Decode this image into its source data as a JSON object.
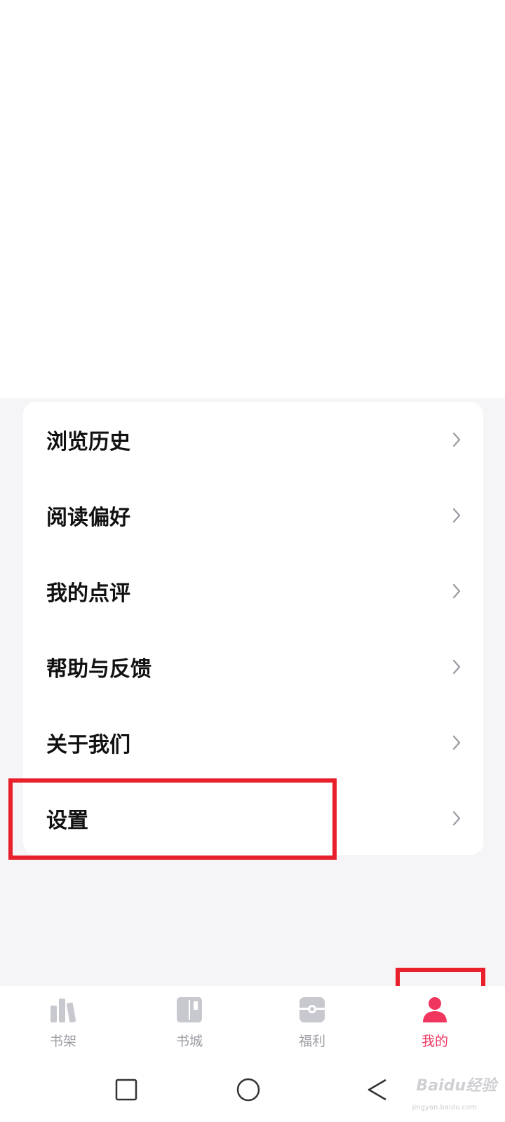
{
  "menu": {
    "items": [
      {
        "label": "浏览历史"
      },
      {
        "label": "阅读偏好"
      },
      {
        "label": "我的点评"
      },
      {
        "label": "帮助与反馈"
      },
      {
        "label": "关于我们"
      },
      {
        "label": "设置"
      }
    ]
  },
  "tabbar": {
    "tabs": [
      {
        "label": "书架",
        "icon": "bookshelf-icon",
        "active": false
      },
      {
        "label": "书城",
        "icon": "bookstore-icon",
        "active": false
      },
      {
        "label": "福利",
        "icon": "gift-icon",
        "active": false
      },
      {
        "label": "我的",
        "icon": "profile-icon",
        "active": true
      }
    ]
  },
  "navbar": {
    "buttons": [
      "recent-apps-icon",
      "home-icon",
      "back-icon"
    ]
  },
  "watermark": {
    "text": "Baidu经验",
    "sub": "jingyan.baidu.com"
  },
  "colors": {
    "accent": "#f0365f",
    "inactive": "#c8c8cf",
    "highlight": "#e8202b",
    "background": "#f5f5f7"
  }
}
